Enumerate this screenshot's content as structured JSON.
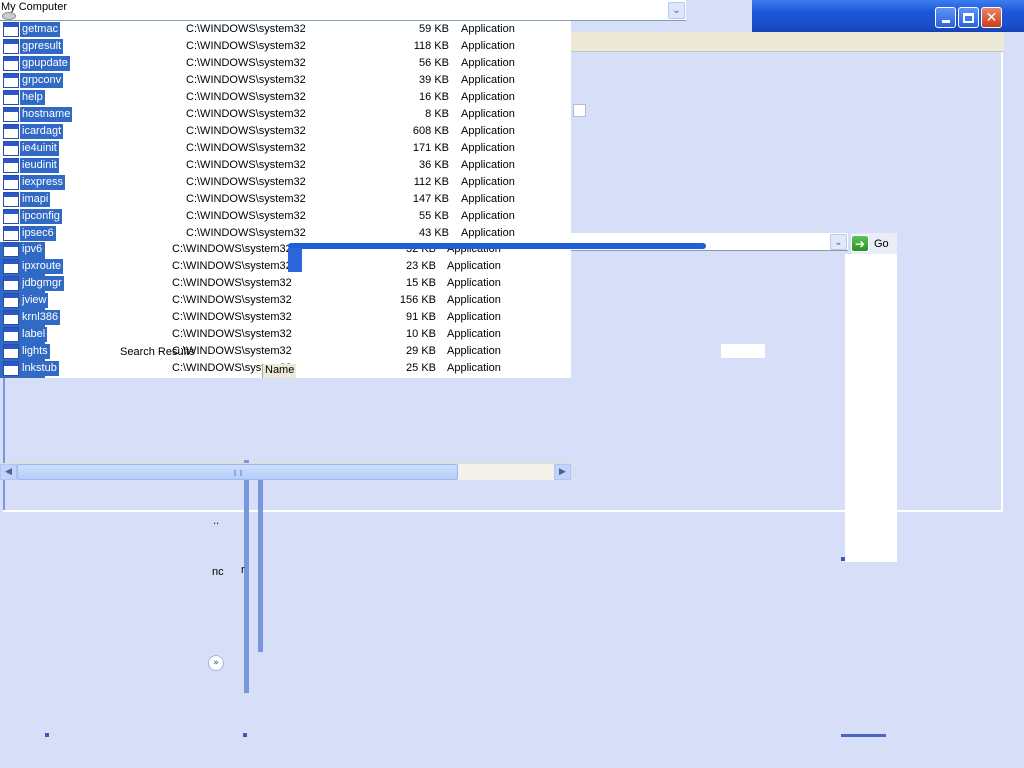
{
  "location_bar": {
    "text": "My Computer"
  },
  "go_button": {
    "label": "Go"
  },
  "search_results": {
    "title": "Search Results",
    "column_header": "Name"
  },
  "file_rows": [
    {
      "name": "getmac",
      "path": "C:\\WINDOWS\\system32",
      "size": "59 KB",
      "type": "Application"
    },
    {
      "name": "gpresult",
      "path": "C:\\WINDOWS\\system32",
      "size": "118 KB",
      "type": "Application"
    },
    {
      "name": "gpupdate",
      "path": "C:\\WINDOWS\\system32",
      "size": "56 KB",
      "type": "Application"
    },
    {
      "name": "grpconv",
      "path": "C:\\WINDOWS\\system32",
      "size": "39 KB",
      "type": "Application"
    },
    {
      "name": "help",
      "path": "C:\\WINDOWS\\system32",
      "size": "16 KB",
      "type": "Application"
    },
    {
      "name": "hostname",
      "path": "C:\\WINDOWS\\system32",
      "size": "8 KB",
      "type": "Application"
    },
    {
      "name": "icardagt",
      "path": "C:\\WINDOWS\\system32",
      "size": "608 KB",
      "type": "Application"
    },
    {
      "name": "ie4uinit",
      "path": "C:\\WINDOWS\\system32",
      "size": "171 KB",
      "type": "Application"
    },
    {
      "name": "ieudinit",
      "path": "C:\\WINDOWS\\system32",
      "size": "36 KB",
      "type": "Application"
    },
    {
      "name": "iexpress",
      "path": "C:\\WINDOWS\\system32",
      "size": "112 KB",
      "type": "Application"
    },
    {
      "name": "imapi",
      "path": "C:\\WINDOWS\\system32",
      "size": "147 KB",
      "type": "Application"
    },
    {
      "name": "ipconfig",
      "path": "C:\\WINDOWS\\system32",
      "size": "55 KB",
      "type": "Application"
    },
    {
      "name": "ipsec6",
      "path": "C:\\WINDOWS\\system32",
      "size": "43 KB",
      "type": "Application"
    },
    {
      "name": "ipv6",
      "path": "C:\\WINDOWS\\system32",
      "size": "32 KB",
      "type": "Application"
    },
    {
      "name": "ipxroute",
      "path": "C:\\WINDOWS\\system32",
      "size": "23 KB",
      "type": "Application"
    },
    {
      "name": "jdbgmgr",
      "path": "C:\\WINDOWS\\system32",
      "size": "15 KB",
      "type": "Application"
    },
    {
      "name": "jview",
      "path": "C:\\WINDOWS\\system32",
      "size": "156 KB",
      "type": "Application"
    },
    {
      "name": "krnl386",
      "path": "C:\\WINDOWS\\system32",
      "size": "91 KB",
      "type": "Application"
    },
    {
      "name": "label",
      "path": "C:\\WINDOWS\\system32",
      "size": "10 KB",
      "type": "Application"
    },
    {
      "name": "lights",
      "path": "C:\\WINDOWS\\system32",
      "size": "29 KB",
      "type": "Application"
    },
    {
      "name": "lnkstub",
      "path": "C:\\WINDOWS\\system32",
      "size": "25 KB",
      "type": "Application"
    }
  ],
  "fragments": {
    "frag1": "..",
    "frag2": "nc",
    "frag3": "r"
  }
}
